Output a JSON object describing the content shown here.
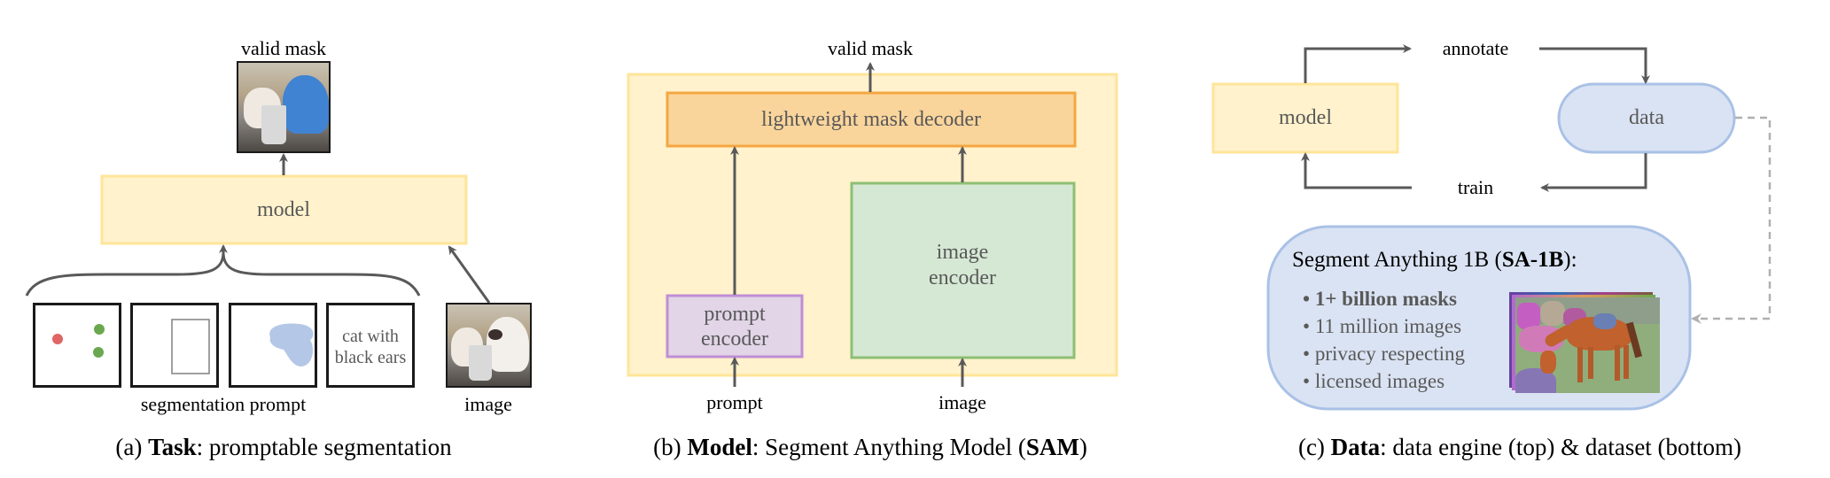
{
  "panel_a": {
    "output_label": "valid mask",
    "model_label": "model",
    "prompt_group_label": "segmentation prompt",
    "image_label": "image",
    "text_prompt_line1": "cat with",
    "text_prompt_line2": "black ears",
    "prompt_types": [
      "points",
      "box",
      "mask",
      "text"
    ],
    "caption_prefix": "(a) ",
    "caption_bold": "Task",
    "caption_rest": ": promptable segmentation"
  },
  "panel_b": {
    "output_label": "valid mask",
    "decoder_label": "lightweight mask decoder",
    "prompt_encoder_line1": "prompt",
    "prompt_encoder_line2": "encoder",
    "image_encoder_line1": "image",
    "image_encoder_line2": "encoder",
    "prompt_input_label": "prompt",
    "image_input_label": "image",
    "caption_prefix": "(b) ",
    "caption_bold": "Model",
    "caption_mid": ": Segment Anything Model (",
    "caption_bold2": "SAM",
    "caption_end": ")"
  },
  "panel_c": {
    "model_label": "model",
    "data_label": "data",
    "annotate_label": "annotate",
    "train_label": "train",
    "dataset_title_prefix": "Segment Anything 1B (",
    "dataset_title_bold": "SA-1B",
    "dataset_title_suffix": "):",
    "bullets": [
      {
        "text": "1+ billion masks",
        "bold": true
      },
      {
        "text": "11 million images",
        "bold": false
      },
      {
        "text": "privacy respecting",
        "bold": false
      },
      {
        "text": "licensed images",
        "bold": false
      }
    ],
    "bullet_glyph": "•",
    "caption_prefix": "(c) ",
    "caption_bold": "Data",
    "caption_rest": ": data engine (top) & dataset (bottom)"
  },
  "colors": {
    "model_fill": "#fff2cc",
    "model_stroke": "#ffe599",
    "decoder_fill": "#fad59b",
    "decoder_stroke": "#f4a742",
    "image_encoder_fill": "#d5e8d4",
    "image_encoder_stroke": "#8dbf74",
    "prompt_encoder_fill": "#e1d5e7",
    "prompt_encoder_stroke": "#bf8ed6",
    "data_fill": "#dae3f3",
    "data_stroke": "#a9c1e6",
    "arrow": "#595959",
    "point_negative": "#e06666",
    "point_positive": "#6aa84f",
    "mask_blob": "#b4c7e7"
  }
}
